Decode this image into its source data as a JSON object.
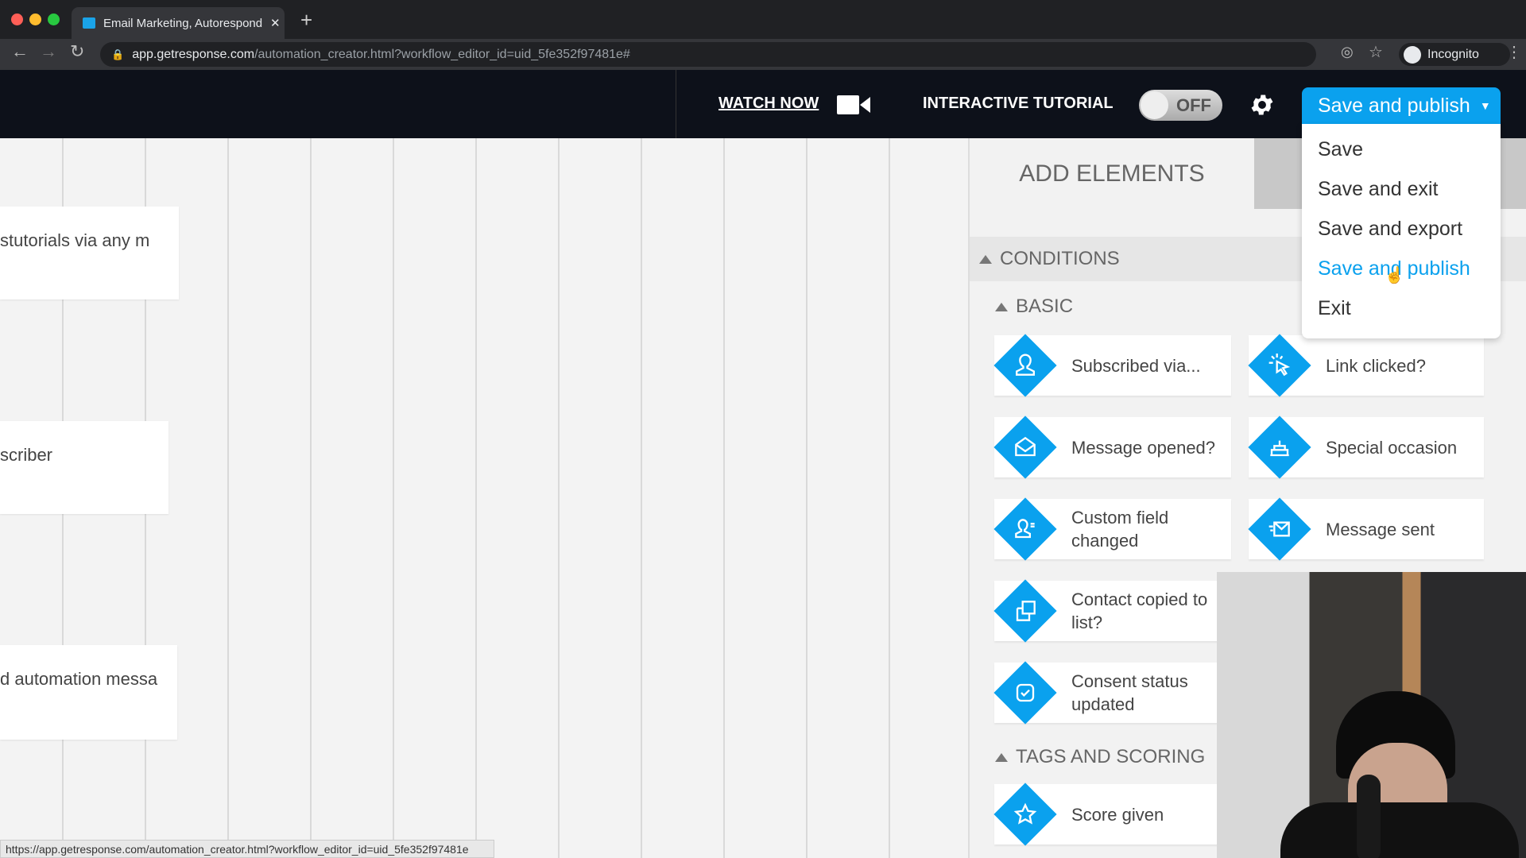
{
  "browser": {
    "tab_title": "Email Marketing, Autoresponders",
    "url_host": "app.getresponse.com",
    "url_path": "/automation_creator.html?workflow_editor_id=uid_5fe352f97481e#",
    "profile": "Incognito"
  },
  "header": {
    "watch_now": "WATCH NOW",
    "tutorial_label": "INTERACTIVE TUTORIAL",
    "toggle_state": "OFF",
    "publish_button": "Save and publish"
  },
  "menu": {
    "items": [
      "Save",
      "Save and exit",
      "Save and export",
      "Save and publish",
      "Exit"
    ],
    "active_index": 3
  },
  "canvas": {
    "nodes": [
      "stutorials via any m",
      "scriber",
      "d automation messa"
    ]
  },
  "panel": {
    "title": "ADD ELEMENTS",
    "section": "CONDITIONS",
    "basic": "BASIC",
    "tags": "TAGS AND SCORING",
    "basic_items": [
      "Subscribed via...",
      "Link clicked?",
      "Message opened?",
      "Special occasion",
      "Custom field changed",
      "Message sent",
      "Contact copied to list?",
      "Consent status updated"
    ],
    "tag_items": [
      "Score given"
    ]
  },
  "status_url": "https://app.getresponse.com/automation_creator.html?workflow_editor_id=uid_5fe352f97481e",
  "colors": {
    "accent": "#0aa1ee",
    "header_bg": "#0d111a"
  }
}
